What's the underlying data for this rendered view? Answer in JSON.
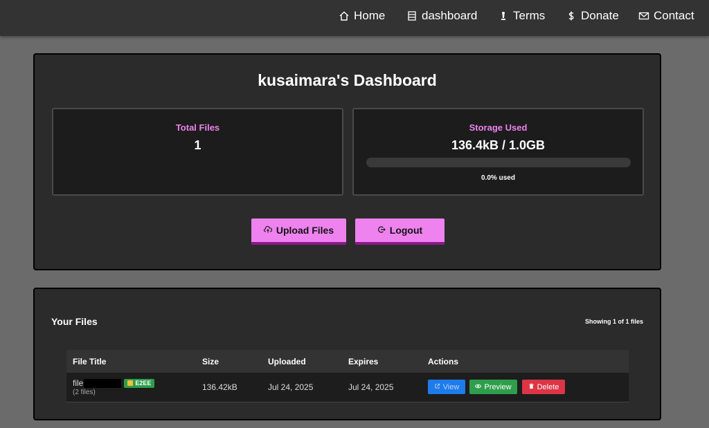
{
  "nav": {
    "items": [
      {
        "label": "Home",
        "icon": "home-icon"
      },
      {
        "label": "dashboard",
        "icon": "list-icon"
      },
      {
        "label": "Terms",
        "icon": "chess-icon"
      },
      {
        "label": "Donate",
        "icon": "dollar-icon"
      },
      {
        "label": "Contact",
        "icon": "mail-icon"
      }
    ]
  },
  "dashboard": {
    "title": "kusaimara's Dashboard",
    "total_files": {
      "label": "Total Files",
      "value": "1"
    },
    "storage": {
      "label": "Storage Used",
      "value": "136.4kB / 1.0GB",
      "percent_text": "0.0% used",
      "percent": 0.0
    },
    "upload_label": "Upload Files",
    "logout_label": "Logout"
  },
  "files": {
    "title": "Your Files",
    "count_text": "Showing 1 of 1 files",
    "columns": [
      "File Title",
      "Size",
      "Uploaded",
      "Expires",
      "Actions"
    ],
    "rows": [
      {
        "name": "file",
        "badge": "E2EE",
        "sub": "(2 files)",
        "size": "136.42kB",
        "uploaded": "Jul 24, 2025",
        "expires": "Jul 24, 2025",
        "actions": {
          "view": "View",
          "preview": "Preview",
          "delete": "Delete"
        }
      }
    ]
  },
  "colors": {
    "accent": "#ee82ee",
    "view": "#1e7bea",
    "preview": "#2f9e4c",
    "delete": "#dc3545"
  }
}
